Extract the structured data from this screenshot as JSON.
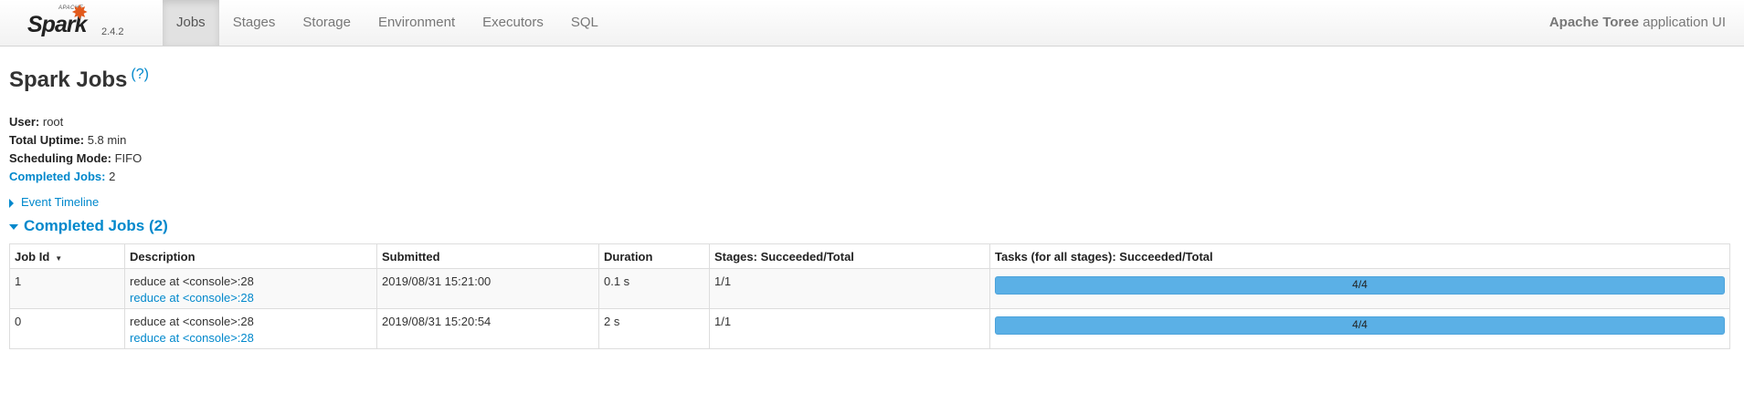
{
  "brand": {
    "apache": "APACHE",
    "name": "Spark",
    "version": "2.4.2"
  },
  "nav": {
    "items": [
      {
        "label": "Jobs",
        "active": true
      },
      {
        "label": "Stages",
        "active": false
      },
      {
        "label": "Storage",
        "active": false
      },
      {
        "label": "Environment",
        "active": false
      },
      {
        "label": "Executors",
        "active": false
      },
      {
        "label": "SQL",
        "active": false
      }
    ],
    "app_name": "Apache Toree",
    "app_suffix": " application UI"
  },
  "page": {
    "title": "Spark Jobs",
    "help": "(?)"
  },
  "summary": {
    "user_label": "User:",
    "user_value": "root",
    "uptime_label": "Total Uptime:",
    "uptime_value": "5.8 min",
    "mode_label": "Scheduling Mode:",
    "mode_value": "FIFO",
    "completed_label": "Completed Jobs:",
    "completed_value": "2"
  },
  "timeline": {
    "label": "Event Timeline"
  },
  "completed_section": {
    "label": "Completed Jobs (2)"
  },
  "table": {
    "headers": [
      "Job Id",
      "Description",
      "Submitted",
      "Duration",
      "Stages: Succeeded/Total",
      "Tasks (for all stages): Succeeded/Total"
    ],
    "sort_indicator": "▼",
    "rows": [
      {
        "job_id": "1",
        "description": "reduce at <console>:28",
        "description_link": "reduce at <console>:28",
        "submitted": "2019/08/31 15:21:00",
        "duration": "0.1 s",
        "stages": "1/1",
        "tasks": "4/4",
        "tasks_fraction": 1.0
      },
      {
        "job_id": "0",
        "description": "reduce at <console>:28",
        "description_link": "reduce at <console>:28",
        "submitted": "2019/08/31 15:20:54",
        "duration": "2 s",
        "stages": "1/1",
        "tasks": "4/4",
        "tasks_fraction": 1.0
      }
    ]
  },
  "colors": {
    "link": "#0088cc",
    "progress": "#5bb0e6",
    "brand_star": "#e25a1c"
  }
}
